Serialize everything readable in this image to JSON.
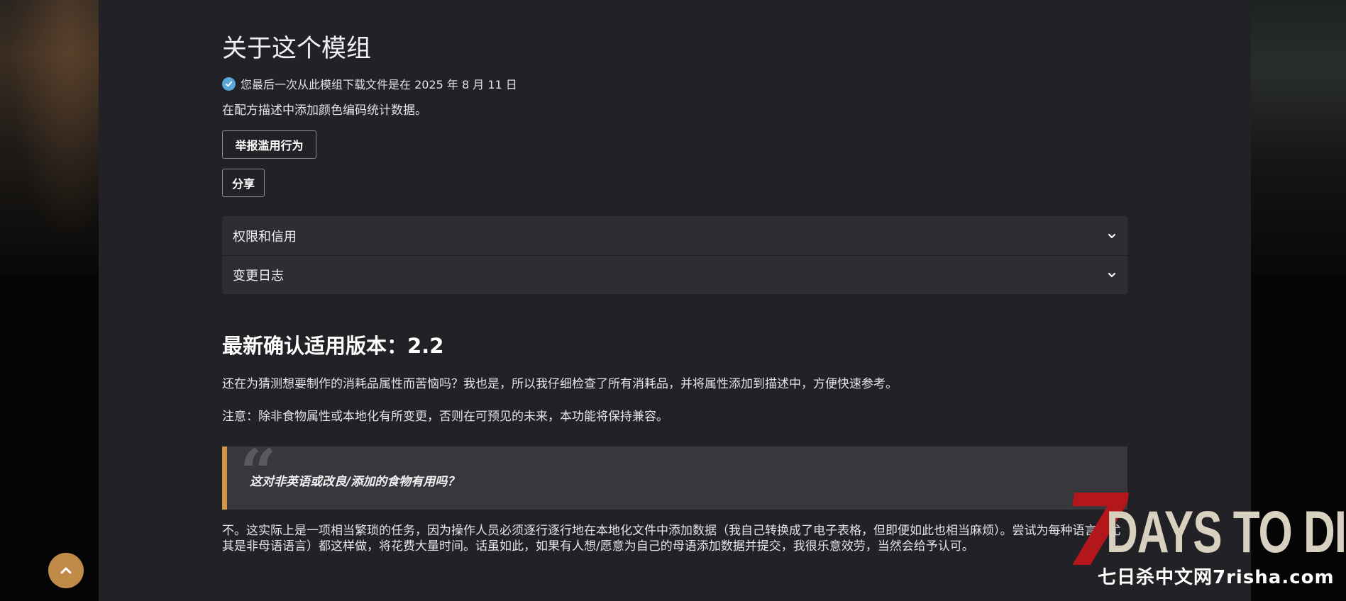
{
  "mod": {
    "about_title": "关于这个模组",
    "download_note": "您最后一次从此模组下载文件是在 2025 年 8 月 11 日",
    "summary": "在配方描述中添加颜色编码统计数据。",
    "report_button": "举报滥用行为",
    "share_button": "分享"
  },
  "accordion": {
    "items": [
      {
        "label": "权限和信用"
      },
      {
        "label": "变更日志"
      }
    ]
  },
  "description": {
    "heading": "最新确认适用版本：2.2",
    "para1": "还在为猜测想要制作的消耗品属性而苦恼吗？我也是，所以我仔细检查了所有消耗品，并将属性添加到描述中，方便快速参考。",
    "para2": "注意：除非食物属性或本地化有所变更，否则在可预见的未来，本功能将保持兼容。",
    "quote": "这对非英语或改良/添加的食物有用吗？",
    "answer": "不。这实际上是一项相当繁琐的任务，因为操作人员必须逐行逐行地在本地化文件中添加数据（我自己转换成了电子表格，但即便如此也相当麻烦）。尝试为每种语言（尤其是非母语语言）都这样做，将花费大量时间。话虽如此，如果有人想/愿意为自己的母语添加数据并提交，我很乐意效劳，当然会给予认可。"
  },
  "watermark": {
    "numeral": "7",
    "title": "DAYS TO DIE",
    "site": "七日杀中文网7risha.com"
  },
  "colors": {
    "panel": "#222125",
    "accent": "#d0964a",
    "scroll_button": "#c08a48",
    "check": "#5aa7d8"
  },
  "icons": {
    "check": "check-circle-icon",
    "chevron": "chevron-down-icon",
    "scroll_top": "chevron-up-icon"
  }
}
